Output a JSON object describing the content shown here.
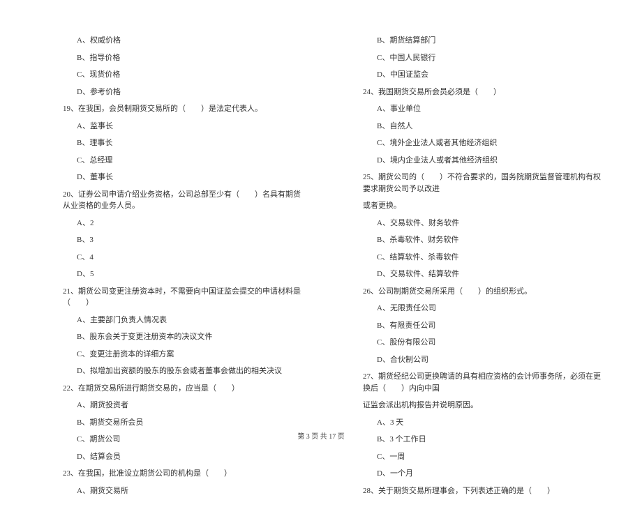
{
  "left_column": [
    {
      "type": "option",
      "text": "A、权威价格"
    },
    {
      "type": "option",
      "text": "B、指导价格"
    },
    {
      "type": "option",
      "text": "C、现货价格"
    },
    {
      "type": "option",
      "text": "D、参考价格"
    },
    {
      "type": "question",
      "text": "19、在我国，会员制期货交易所的（　　）是法定代表人。"
    },
    {
      "type": "option",
      "text": "A、监事长"
    },
    {
      "type": "option",
      "text": "B、理事长"
    },
    {
      "type": "option",
      "text": "C、总经理"
    },
    {
      "type": "option",
      "text": "D、董事长"
    },
    {
      "type": "question",
      "text": "20、证券公司申请介绍业务资格，公司总部至少有（　　）名具有期货从业资格的业务人员。"
    },
    {
      "type": "option",
      "text": "A、2"
    },
    {
      "type": "option",
      "text": "B、3"
    },
    {
      "type": "option",
      "text": "C、4"
    },
    {
      "type": "option",
      "text": "D、5"
    },
    {
      "type": "question",
      "text": "21、期货公司变更注册资本时，不需要向中国证监会提交的申请材料是（　　）"
    },
    {
      "type": "option",
      "text": "A、主要部门负责人情况表"
    },
    {
      "type": "option",
      "text": "B、股东会关于变更注册资本的决议文件"
    },
    {
      "type": "option",
      "text": "C、变更注册资本的详细方案"
    },
    {
      "type": "option",
      "text": "D、拟增加出资额的股东的股东会或者董事会做出的相关决议"
    },
    {
      "type": "question",
      "text": "22、在期货交易所进行期货交易的，应当是（　　）"
    },
    {
      "type": "option",
      "text": "A、期货投资者"
    },
    {
      "type": "option",
      "text": "B、期货交易所会员"
    },
    {
      "type": "option",
      "text": "C、期货公司"
    },
    {
      "type": "option",
      "text": "D、结算会员"
    },
    {
      "type": "question",
      "text": "23、在我国，批准设立期货公司的机构是（　　）"
    },
    {
      "type": "option",
      "text": "A、期货交易所"
    }
  ],
  "right_column": [
    {
      "type": "option",
      "text": "B、期货结算部门"
    },
    {
      "type": "option",
      "text": "C、中国人民银行"
    },
    {
      "type": "option",
      "text": "D、中国证监会"
    },
    {
      "type": "question",
      "text": "24、我国期货交易所会员必须是（　　）"
    },
    {
      "type": "option",
      "text": "A、事业单位"
    },
    {
      "type": "option",
      "text": "B、自然人"
    },
    {
      "type": "option",
      "text": "C、境外企业法人或者其他经济组织"
    },
    {
      "type": "option",
      "text": "D、境内企业法人或者其他经济组织"
    },
    {
      "type": "question",
      "text": "25、期货公司的（　　）不符合要求的，国务院期货监督管理机构有权要求期货公司予以改进"
    },
    {
      "type": "question-cont",
      "text": "或者更换。"
    },
    {
      "type": "option",
      "text": "A、交易软件、财务软件"
    },
    {
      "type": "option",
      "text": "B、杀毒软件、财务软件"
    },
    {
      "type": "option",
      "text": "C、结算软件、杀毒软件"
    },
    {
      "type": "option",
      "text": "D、交易软件、结算软件"
    },
    {
      "type": "question",
      "text": "26、公司制期货交易所采用（　　）的组织形式。"
    },
    {
      "type": "option",
      "text": "A、无限责任公司"
    },
    {
      "type": "option",
      "text": "B、有限责任公司"
    },
    {
      "type": "option",
      "text": "C、股份有限公司"
    },
    {
      "type": "option",
      "text": "D、合伙制公司"
    },
    {
      "type": "question",
      "text": "27、期货经纪公司更换聘请的具有相应资格的会计师事务所，必须在更换后（　　）内向中国"
    },
    {
      "type": "question-cont",
      "text": "证监会派出机构报告并说明原因。"
    },
    {
      "type": "option",
      "text": "A、3 天"
    },
    {
      "type": "option",
      "text": "B、3 个工作日"
    },
    {
      "type": "option",
      "text": "C、一周"
    },
    {
      "type": "option",
      "text": "D、一个月"
    },
    {
      "type": "question",
      "text": "28、关于期货交易所理事会，下列表述正确的是（　　）"
    }
  ],
  "footer": "第 3 页 共 17 页"
}
